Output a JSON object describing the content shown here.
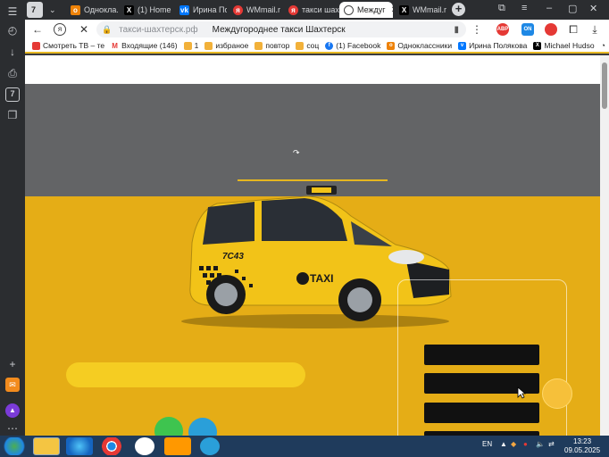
{
  "sidebar": {
    "tab_count_badge": "7"
  },
  "tabs": [
    {
      "label": "7",
      "favicon": "count-badge",
      "color": "#5f6368"
    },
    {
      "label": "Однокла...",
      "favicon": "ok-icon",
      "color": "#ee8208"
    },
    {
      "label": "(1) Home",
      "favicon": "x-icon",
      "color": "#000000"
    },
    {
      "label": "Ирина По",
      "favicon": "vk-icon",
      "color": "#0077ff"
    },
    {
      "label": "WMmail.r",
      "favicon": "yandex-icon",
      "color": "#e53935"
    },
    {
      "label": "такси шах",
      "favicon": "yandex-icon",
      "color": "#e53935"
    },
    {
      "label": "Междуг",
      "favicon": "page-icon",
      "color": "#ffffff",
      "active": true
    },
    {
      "label": "WMmail.r",
      "favicon": "x-icon",
      "color": "#000000"
    }
  ],
  "address": {
    "host": "такси-шахтерск.рф",
    "title": "Междугороднее такси Шахтерск"
  },
  "extensions": [
    {
      "name": "adblock-icon",
      "label": "ABP",
      "color": "#e53935"
    },
    {
      "name": "extension-blue-icon",
      "label": "ON",
      "color": "#1e88e5"
    },
    {
      "name": "extension-red-icon",
      "label": "",
      "color": "#e53935"
    }
  ],
  "bookmarks": [
    {
      "label": "Смотреть ТВ – те",
      "favicon": "tv-icon",
      "color": "#e53935"
    },
    {
      "label": "Входящие (146)",
      "favicon": "gmail-icon",
      "color": "#e53935"
    },
    {
      "label": "1",
      "favicon": "folder-icon",
      "color": "#f2b13a"
    },
    {
      "label": "избраное",
      "favicon": "folder-icon",
      "color": "#f2b13a"
    },
    {
      "label": "повтор",
      "favicon": "folder-icon",
      "color": "#f2b13a"
    },
    {
      "label": "соц",
      "favicon": "folder-icon",
      "color": "#f2b13a"
    },
    {
      "label": "(1) Facebook",
      "favicon": "facebook-icon",
      "color": "#1877f2"
    },
    {
      "label": "Одноклассники",
      "favicon": "ok-icon",
      "color": "#ee8208"
    },
    {
      "label": "Ирина Полякова",
      "favicon": "vk-icon",
      "color": "#0077ff"
    },
    {
      "label": "Michael Hudso",
      "favicon": "x-icon",
      "color": "#000000"
    }
  ],
  "page": {
    "taxi_sign": "TAXI",
    "taxi_number": "7C43"
  },
  "taskbar": {
    "lang": "EN",
    "time": "13:23",
    "date": "09.05.2025"
  }
}
